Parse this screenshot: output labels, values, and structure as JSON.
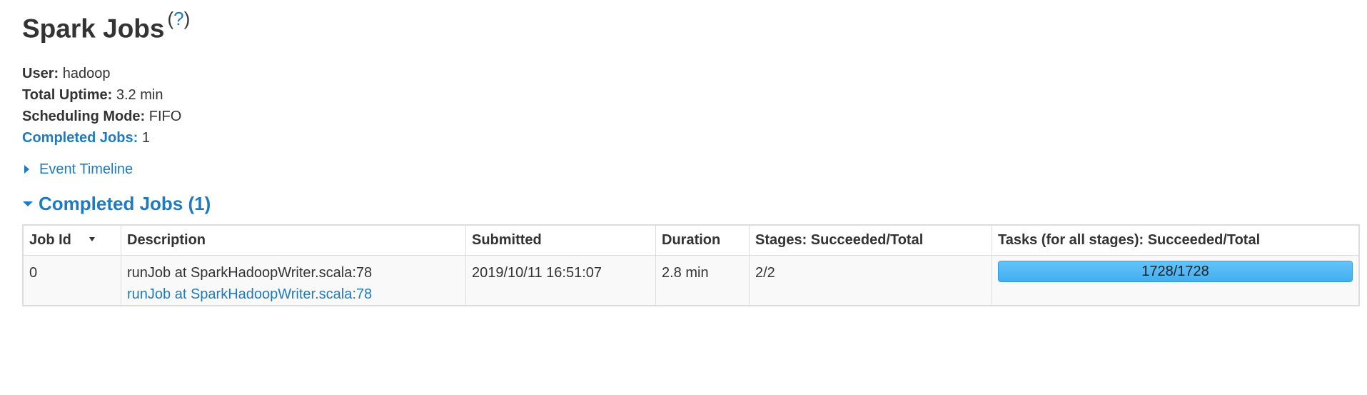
{
  "page": {
    "title": "Spark Jobs",
    "help_label": "(?)",
    "help_link_char": "?"
  },
  "summary": {
    "user_label": "User:",
    "user_value": "hadoop",
    "uptime_label": "Total Uptime:",
    "uptime_value": "3.2 min",
    "scheduling_label": "Scheduling Mode:",
    "scheduling_value": "FIFO",
    "completed_label": "Completed Jobs:",
    "completed_value": "1"
  },
  "event_timeline": {
    "label": "Event Timeline"
  },
  "completed_section": {
    "title": "Completed Jobs (1)"
  },
  "table": {
    "headers": [
      "Job Id",
      "Description",
      "Submitted",
      "Duration",
      "Stages: Succeeded/Total",
      "Tasks (for all stages): Succeeded/Total"
    ],
    "rows": [
      {
        "job_id": "0",
        "description": "runJob at SparkHadoopWriter.scala:78",
        "description_link": "runJob at SparkHadoopWriter.scala:78",
        "submitted": "2019/10/11 16:51:07",
        "duration": "2.8 min",
        "stages": "2/2",
        "tasks_text": "1728/1728",
        "tasks_progress": 1.0
      }
    ]
  },
  "colors": {
    "link": "#1f7bc1",
    "progress": "#42aeef",
    "text": "#333333"
  }
}
